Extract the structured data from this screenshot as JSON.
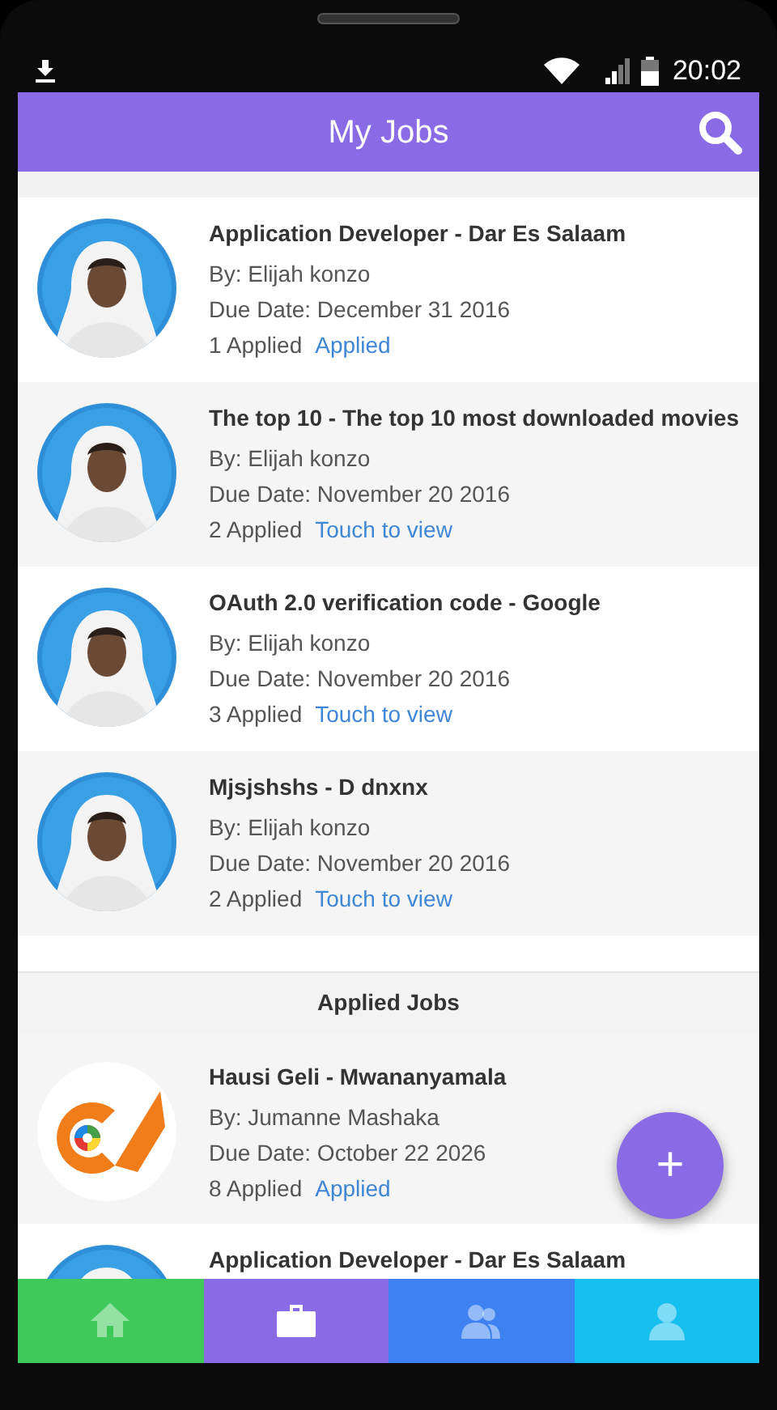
{
  "status_bar": {
    "time": "20:02"
  },
  "app_bar": {
    "title": "My Jobs"
  },
  "sections": [
    {
      "jobs": [
        {
          "kind": "picture",
          "title": "Application Developer - Dar Es Salaam",
          "by": "By: Elijah konzo",
          "due": "Due Date: December 31 2016",
          "count": "1 Applied",
          "action": "Applied"
        },
        {
          "kind": "picture",
          "title": "The top 10 - The top 10 most downloaded movies",
          "by": "By: Elijah konzo",
          "due": "Due Date: November 20 2016",
          "count": "2 Applied",
          "action": "Touch to view"
        },
        {
          "kind": "picture",
          "title": "OAuth 2.0 verification code - Google",
          "by": "By: Elijah konzo",
          "due": "Due Date: November 20 2016",
          "count": "3 Applied",
          "action": "Touch to view"
        },
        {
          "kind": "picture",
          "title": "Mjsjshshs - D dnxnx",
          "by": "By: Elijah konzo",
          "due": "Due Date: November 20 2016",
          "count": "2 Applied",
          "action": "Touch to view"
        }
      ]
    },
    {
      "header": "Applied Jobs",
      "jobs": [
        {
          "kind": "logo",
          "title": "Hausi Geli - Mwananyamala",
          "by": "By: Jumanne Mashaka",
          "due": "Due Date: October 22 2026",
          "count": "8 Applied",
          "action": "Applied"
        },
        {
          "kind": "picture",
          "title": "Application Developer - Dar Es Salaam"
        }
      ]
    }
  ],
  "fab": {
    "label": "+"
  },
  "bottom_nav": [
    {
      "kind": "home",
      "color": "#3ec95a",
      "selected": false
    },
    {
      "kind": "jobs",
      "color": "#8a6be6",
      "selected": true
    },
    {
      "kind": "people",
      "color": "#3d82f0",
      "selected": false
    },
    {
      "kind": "profile",
      "color": "#16c0ee",
      "selected": false
    }
  ]
}
